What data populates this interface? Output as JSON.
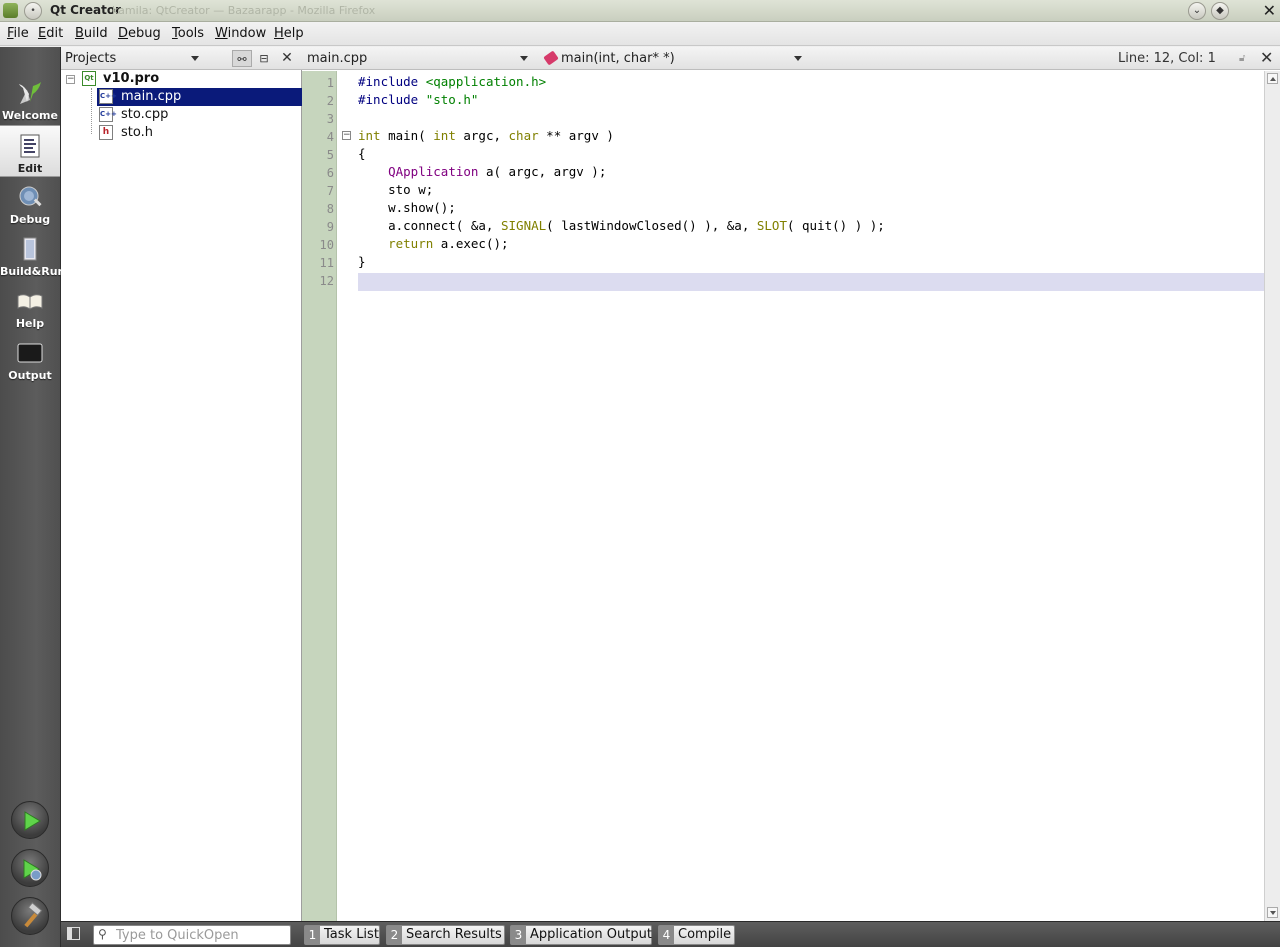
{
  "window": {
    "title": "Qt Creator",
    "ghost_title": "kamila: QtCreator — Bazaarapp - Mozilla Firefox"
  },
  "menubar": [
    "File",
    "Edit",
    "Build",
    "Debug",
    "Tools",
    "Window",
    "Help"
  ],
  "modes": [
    {
      "label": "Welcome",
      "icon": "welcome-icon",
      "active": false
    },
    {
      "label": "Edit",
      "icon": "edit-icon",
      "active": true
    },
    {
      "label": "Debug",
      "icon": "debug-icon",
      "active": false
    },
    {
      "label": "Build&Run",
      "icon": "build-run-icon",
      "active": false
    },
    {
      "label": "Help",
      "icon": "help-book-icon",
      "active": false
    },
    {
      "label": "Output",
      "icon": "output-icon",
      "active": false
    }
  ],
  "projects": {
    "title": "Projects",
    "tree": [
      {
        "label": "v10.pro",
        "type": "project",
        "selected": false
      },
      {
        "label": "main.cpp",
        "type": "cpp",
        "selected": true
      },
      {
        "label": "sto.cpp",
        "type": "cpp",
        "selected": false
      },
      {
        "label": "sto.h",
        "type": "header",
        "selected": false
      }
    ]
  },
  "editor": {
    "file": "main.cpp",
    "symbol": "main(int, char* *)",
    "position": "Line: 12, Col: 1",
    "current_line": 12,
    "lines": [
      "#include <qapplication.h>",
      "#include \"sto.h\"",
      "",
      "int main( int argc, char ** argv )",
      "{",
      "    QApplication a( argc, argv );",
      "    sto w;",
      "    w.show();",
      "    a.connect( &a, SIGNAL( lastWindowClosed() ), &a, SLOT( quit() ) );",
      "    return a.exec();",
      "}",
      ""
    ]
  },
  "statusbar": {
    "quickopen_placeholder": "Type to QuickOpen",
    "tabs": [
      {
        "num": "1",
        "label": "Task List"
      },
      {
        "num": "2",
        "label": "Search Results"
      },
      {
        "num": "3",
        "label": "Application Output"
      },
      {
        "num": "4",
        "label": "Compile"
      }
    ]
  }
}
